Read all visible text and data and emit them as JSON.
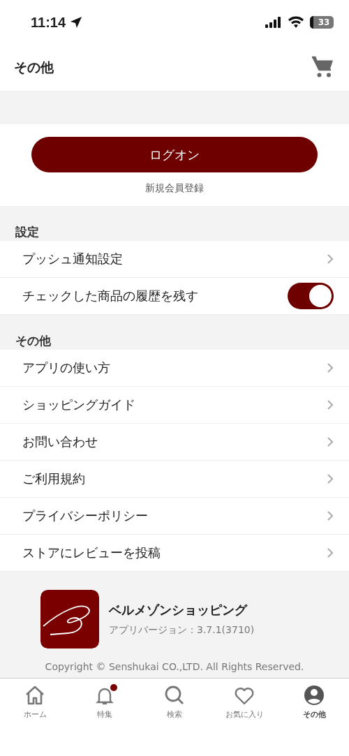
{
  "status_bar": {
    "time": "11:14",
    "battery": "33"
  },
  "header": {
    "title": "その他"
  },
  "login": {
    "button": "ログオン",
    "register_link": "新規会員登録"
  },
  "sections": [
    {
      "title": "設定",
      "items": [
        {
          "kind": "link",
          "label": "プッシュ通知設定"
        },
        {
          "kind": "toggle",
          "label": "チェックした商品の履歴を残す",
          "on": true
        }
      ]
    },
    {
      "title": "その他",
      "items": [
        {
          "kind": "link",
          "label": "アプリの使い方"
        },
        {
          "kind": "link",
          "label": "ショッピングガイド"
        },
        {
          "kind": "link",
          "label": "お問い合わせ"
        },
        {
          "kind": "link",
          "label": "ご利用規約"
        },
        {
          "kind": "link",
          "label": "プライバシーポリシー"
        },
        {
          "kind": "link",
          "label": "ストアにレビューを投稿"
        }
      ]
    }
  ],
  "app_info": {
    "name": "ベルメゾンショッピング",
    "version": "アプリバージョン：3.7.1(3710)",
    "copyright": "Copyright © Senshukai CO.,LTD. All Rights Reserved."
  },
  "tab_bar": [
    {
      "kind": "home",
      "label": "ホーム",
      "selected": false,
      "badge": false
    },
    {
      "kind": "bell",
      "label": "特集",
      "selected": false,
      "badge": true
    },
    {
      "kind": "search",
      "label": "検索",
      "selected": false,
      "badge": false
    },
    {
      "kind": "heart",
      "label": "お気に入り",
      "selected": false,
      "badge": false
    },
    {
      "kind": "person",
      "label": "その他",
      "selected": true,
      "badge": false
    }
  ]
}
